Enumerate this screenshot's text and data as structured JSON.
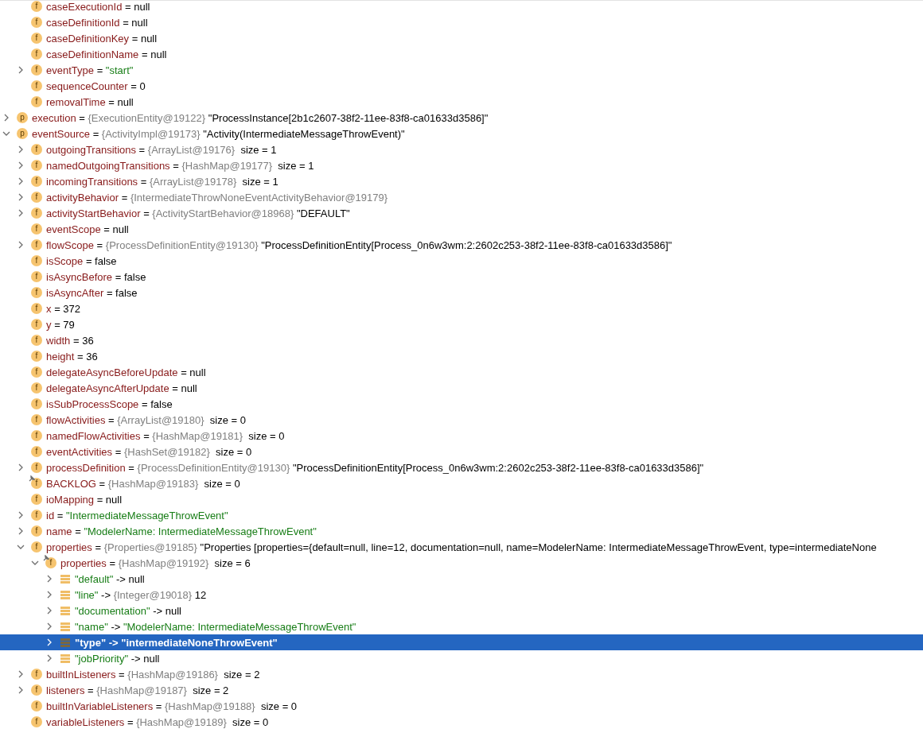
{
  "variables_tree": {
    "clipped_parent_children": [
      {
        "kind": "field",
        "badge": "f",
        "name": "caseExecutionId",
        "sep": "=",
        "value": "null",
        "string_literal": false,
        "expandable": false,
        "selected": false
      },
      {
        "kind": "field",
        "badge": "f",
        "name": "caseDefinitionId",
        "sep": "=",
        "value": "null",
        "string_literal": false,
        "expandable": false,
        "selected": false
      },
      {
        "kind": "field",
        "badge": "f",
        "name": "caseDefinitionKey",
        "sep": "=",
        "value": "null",
        "string_literal": false,
        "expandable": false,
        "selected": false
      },
      {
        "kind": "field",
        "badge": "f",
        "name": "caseDefinitionName",
        "sep": "=",
        "value": "null",
        "string_literal": false,
        "expandable": false,
        "selected": false
      },
      {
        "kind": "field",
        "badge": "f",
        "name": "eventType",
        "sep": "=",
        "value": "\"start\"",
        "string_literal": true,
        "expandable": true,
        "expanded": false,
        "selected": false
      },
      {
        "kind": "field",
        "badge": "f",
        "name": "sequenceCounter",
        "sep": "=",
        "value": "0",
        "string_literal": false,
        "expandable": false,
        "selected": false
      },
      {
        "kind": "field",
        "badge": "f",
        "name": "removalTime",
        "sep": "=",
        "value": "null",
        "string_literal": false,
        "expandable": false,
        "selected": false
      }
    ],
    "items": [
      {
        "kind": "field",
        "badge": "p",
        "name": "execution",
        "sep": "=",
        "type": "{ExecutionEntity@19122}",
        "value": "\"ProcessInstance[2b1c2607-38f2-11ee-83f8-ca01633d3586]\"",
        "string_literal": false,
        "expandable": true,
        "expanded": false,
        "selected": false
      },
      {
        "kind": "field",
        "badge": "p",
        "name": "eventSource",
        "sep": "=",
        "type": "{ActivityImpl@19173}",
        "value": "\"Activity(IntermediateMessageThrowEvent)\"",
        "string_literal": false,
        "expandable": true,
        "expanded": true,
        "selected": false,
        "children": [
          {
            "kind": "field",
            "badge": "f",
            "name": "outgoingTransitions",
            "sep": "=",
            "type": "{ArrayList@19176}",
            "size": "size = 1",
            "expandable": true,
            "expanded": false,
            "selected": false
          },
          {
            "kind": "field",
            "badge": "f",
            "name": "namedOutgoingTransitions",
            "sep": "=",
            "type": "{HashMap@19177}",
            "size": "size = 1",
            "expandable": true,
            "expanded": false,
            "selected": false
          },
          {
            "kind": "field",
            "badge": "f",
            "name": "incomingTransitions",
            "sep": "=",
            "type": "{ArrayList@19178}",
            "size": "size = 1",
            "expandable": true,
            "expanded": false,
            "selected": false
          },
          {
            "kind": "field",
            "badge": "f",
            "name": "activityBehavior",
            "sep": "=",
            "type": "{IntermediateThrowNoneEventActivityBehavior@19179}",
            "expandable": true,
            "expanded": false,
            "selected": false
          },
          {
            "kind": "field",
            "badge": "f",
            "name": "activityStartBehavior",
            "sep": "=",
            "type": "{ActivityStartBehavior@18968}",
            "value": "\"DEFAULT\"",
            "string_literal": false,
            "expandable": true,
            "expanded": false,
            "selected": false
          },
          {
            "kind": "field",
            "badge": "f",
            "name": "eventScope",
            "sep": "=",
            "value": "null",
            "string_literal": false,
            "expandable": false,
            "selected": false
          },
          {
            "kind": "field",
            "badge": "f",
            "name": "flowScope",
            "sep": "=",
            "type": "{ProcessDefinitionEntity@19130}",
            "value": "\"ProcessDefinitionEntity[Process_0n6w3wm:2:2602c253-38f2-11ee-83f8-ca01633d3586]\"",
            "string_literal": false,
            "expandable": true,
            "expanded": false,
            "selected": false
          },
          {
            "kind": "field",
            "badge": "f",
            "name": "isScope",
            "sep": "=",
            "value": "false",
            "string_literal": false,
            "expandable": false,
            "selected": false
          },
          {
            "kind": "field",
            "badge": "f",
            "name": "isAsyncBefore",
            "sep": "=",
            "value": "false",
            "string_literal": false,
            "expandable": false,
            "selected": false
          },
          {
            "kind": "field",
            "badge": "f",
            "name": "isAsyncAfter",
            "sep": "=",
            "value": "false",
            "string_literal": false,
            "expandable": false,
            "selected": false
          },
          {
            "kind": "field",
            "badge": "f",
            "name": "x",
            "sep": "=",
            "value": "372",
            "string_literal": false,
            "expandable": false,
            "selected": false
          },
          {
            "kind": "field",
            "badge": "f",
            "name": "y",
            "sep": "=",
            "value": "79",
            "string_literal": false,
            "expandable": false,
            "selected": false
          },
          {
            "kind": "field",
            "badge": "f",
            "name": "width",
            "sep": "=",
            "value": "36",
            "string_literal": false,
            "expandable": false,
            "selected": false
          },
          {
            "kind": "field",
            "badge": "f",
            "name": "height",
            "sep": "=",
            "value": "36",
            "string_literal": false,
            "expandable": false,
            "selected": false
          },
          {
            "kind": "field",
            "badge": "f",
            "name": "delegateAsyncBeforeUpdate",
            "sep": "=",
            "value": "null",
            "string_literal": false,
            "expandable": false,
            "selected": false
          },
          {
            "kind": "field",
            "badge": "f",
            "name": "delegateAsyncAfterUpdate",
            "sep": "=",
            "value": "null",
            "string_literal": false,
            "expandable": false,
            "selected": false
          },
          {
            "kind": "field",
            "badge": "f",
            "name": "isSubProcessScope",
            "sep": "=",
            "value": "false",
            "string_literal": false,
            "expandable": false,
            "selected": false
          },
          {
            "kind": "field",
            "badge": "f",
            "name": "flowActivities",
            "sep": "=",
            "type": "{ArrayList@19180}",
            "size": "size = 0",
            "expandable": false,
            "selected": false
          },
          {
            "kind": "field",
            "badge": "f",
            "name": "namedFlowActivities",
            "sep": "=",
            "type": "{HashMap@19181}",
            "size": "size = 0",
            "expandable": false,
            "selected": false
          },
          {
            "kind": "field",
            "badge": "f",
            "name": "eventActivities",
            "sep": "=",
            "type": "{HashSet@19182}",
            "size": "size = 0",
            "expandable": false,
            "selected": false
          },
          {
            "kind": "field",
            "badge": "f",
            "name": "processDefinition",
            "sep": "=",
            "type": "{ProcessDefinitionEntity@19130}",
            "value": "\"ProcessDefinitionEntity[Process_0n6w3wm:2:2602c253-38f2-11ee-83f8-ca01633d3586]\"",
            "string_literal": false,
            "expandable": true,
            "expanded": false,
            "selected": false
          },
          {
            "kind": "field",
            "badge": "f",
            "pinned": true,
            "name": "BACKLOG",
            "sep": "=",
            "type": "{HashMap@19183}",
            "size": "size = 0",
            "expandable": false,
            "selected": false
          },
          {
            "kind": "field",
            "badge": "f",
            "name": "ioMapping",
            "sep": "=",
            "value": "null",
            "string_literal": false,
            "expandable": false,
            "selected": false
          },
          {
            "kind": "field",
            "badge": "f",
            "name": "id",
            "sep": "=",
            "value": "\"IntermediateMessageThrowEvent\"",
            "string_literal": true,
            "expandable": true,
            "expanded": false,
            "selected": false
          },
          {
            "kind": "field",
            "badge": "f",
            "name": "name",
            "sep": "=",
            "value": "\"ModelerName: IntermediateMessageThrowEvent\"",
            "string_literal": true,
            "expandable": true,
            "expanded": false,
            "selected": false
          },
          {
            "kind": "field",
            "badge": "f",
            "name": "properties",
            "sep": "=",
            "type": "{Properties@19185}",
            "value": "\"Properties [properties={default=null, line=12, documentation=null, name=ModelerName: IntermediateMessageThrowEvent, type=intermediateNone",
            "string_literal": false,
            "expandable": true,
            "expanded": true,
            "selected": false,
            "children": [
              {
                "kind": "field",
                "badge": "f",
                "pinned": true,
                "name": "properties",
                "sep": "=",
                "type": "{HashMap@19192}",
                "size": "size = 6",
                "expandable": true,
                "expanded": true,
                "selected": false,
                "children": [
                  {
                    "kind": "entry",
                    "name": "\"default\"",
                    "sep": "->",
                    "value": "null",
                    "string_literal": false,
                    "expandable": true,
                    "expanded": false,
                    "selected": false
                  },
                  {
                    "kind": "entry",
                    "name": "\"line\"",
                    "sep": "->",
                    "type": "{Integer@19018}",
                    "value": "12",
                    "string_literal": false,
                    "expandable": true,
                    "expanded": false,
                    "selected": false
                  },
                  {
                    "kind": "entry",
                    "name": "\"documentation\"",
                    "sep": "->",
                    "value": "null",
                    "string_literal": false,
                    "expandable": true,
                    "expanded": false,
                    "selected": false
                  },
                  {
                    "kind": "entry",
                    "name": "\"name\"",
                    "sep": "->",
                    "value": "\"ModelerName: IntermediateMessageThrowEvent\"",
                    "string_literal": true,
                    "expandable": true,
                    "expanded": false,
                    "selected": false
                  },
                  {
                    "kind": "entry",
                    "name": "\"type\"",
                    "sep": "->",
                    "value": "\"intermediateNoneThrowEvent\"",
                    "string_literal": true,
                    "expandable": true,
                    "expanded": false,
                    "selected": true
                  },
                  {
                    "kind": "entry",
                    "name": "\"jobPriority\"",
                    "sep": "->",
                    "value": "null",
                    "string_literal": false,
                    "expandable": true,
                    "expanded": false,
                    "selected": false
                  }
                ]
              }
            ]
          },
          {
            "kind": "field",
            "badge": "f",
            "name": "builtInListeners",
            "sep": "=",
            "type": "{HashMap@19186}",
            "size": "size = 2",
            "expandable": true,
            "expanded": false,
            "selected": false
          },
          {
            "kind": "field",
            "badge": "f",
            "name": "listeners",
            "sep": "=",
            "type": "{HashMap@19187}",
            "size": "size = 2",
            "expandable": true,
            "expanded": false,
            "selected": false
          },
          {
            "kind": "field",
            "badge": "f",
            "name": "builtInVariableListeners",
            "sep": "=",
            "type": "{HashMap@19188}",
            "size": "size = 0",
            "expandable": false,
            "selected": false
          },
          {
            "kind": "field",
            "badge": "f",
            "name": "variableListeners",
            "sep": "=",
            "type": "{HashMap@19189}",
            "size": "size = 0",
            "expandable": false,
            "selected": false
          }
        ]
      }
    ]
  }
}
